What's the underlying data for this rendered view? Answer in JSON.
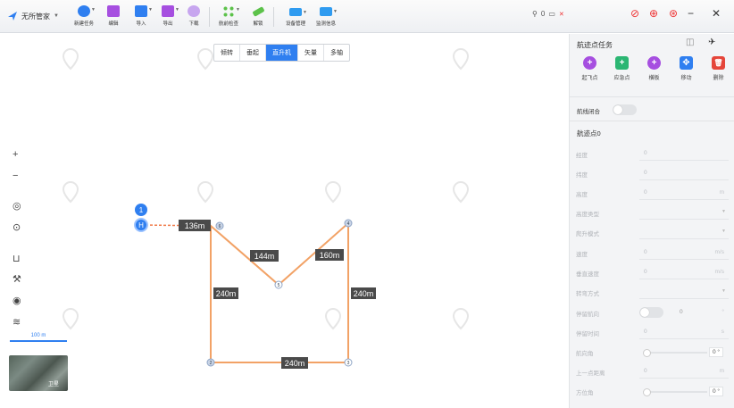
{
  "app": {
    "brand": "无所管家"
  },
  "toolbar": {
    "items": [
      {
        "label": "新建任务",
        "icon": "plus-circle-icon",
        "color": "#2f7ff0"
      },
      {
        "label": "编辑",
        "icon": "edit-icon",
        "color": "#a64fe0"
      },
      {
        "label": "导入",
        "icon": "import-icon",
        "color": "#2f7ff0"
      },
      {
        "label": "导出",
        "icon": "export-icon",
        "color": "#a64fe0"
      },
      {
        "label": "下载",
        "icon": "download-icon",
        "color": "#c7a6ef"
      },
      {
        "label": "航前检查",
        "icon": "checklist-icon",
        "color": "#5cc24a"
      },
      {
        "label": "解锁",
        "icon": "unlock-icon",
        "color": "#5cc24a"
      },
      {
        "label": "设备管理",
        "icon": "device-icon",
        "color": "#2f9bf0"
      },
      {
        "label": "监测信息",
        "icon": "monitor-icon",
        "color": "#2f9bf0"
      }
    ]
  },
  "status": {
    "signal_count": "0"
  },
  "map": {
    "modes": [
      "倾转",
      "垂起",
      "直升机",
      "矢量",
      "多轴"
    ],
    "active_mode": "直升机",
    "left_tools": [
      "+",
      "−"
    ],
    "scale_label": "100 m",
    "thumbnail_label": "卫星",
    "route": {
      "start_labels": [
        "1",
        "H"
      ],
      "distance_labels": [
        "136m",
        "144m",
        "160m",
        "240m",
        "240m",
        "240m"
      ],
      "waypoint_labels": [
        "6",
        "5",
        "4",
        "3",
        "2",
        "1"
      ]
    }
  },
  "panel": {
    "title": "航迹点任务",
    "actions": [
      {
        "label": "起飞点",
        "color": "#a64fe0",
        "glyph": "+"
      },
      {
        "label": "应急点",
        "color": "#2bb673",
        "glyph": "+"
      },
      {
        "label": "横板",
        "color": "#a64fe0",
        "glyph": "+"
      },
      {
        "label": "移动",
        "color": "#2f7ff0",
        "glyph": "✥"
      },
      {
        "label": "删除",
        "color": "#e5453a",
        "glyph": "🗑"
      }
    ],
    "closed_loop_label": "航线闭合",
    "waypoint_title": "航迹点0",
    "fields": [
      {
        "key": "经度",
        "value": "0",
        "unit": ""
      },
      {
        "key": "纬度",
        "value": "0",
        "unit": ""
      },
      {
        "key": "高度",
        "value": "0",
        "unit": "m"
      },
      {
        "key": "高度类型",
        "value": "",
        "unit": "",
        "dropdown": true
      },
      {
        "key": "爬升模式",
        "value": "",
        "unit": "",
        "dropdown": true
      },
      {
        "key": "速度",
        "value": "0",
        "unit": "m/s"
      },
      {
        "key": "垂直速度",
        "value": "0",
        "unit": "m/s"
      },
      {
        "key": "转弯方式",
        "value": "",
        "unit": "",
        "dropdown": true
      },
      {
        "key": "停留航向",
        "value": "0",
        "unit": "°",
        "toggle": true
      },
      {
        "key": "停留时间",
        "value": "0",
        "unit": "s"
      },
      {
        "key": "航向角",
        "value": "0 °",
        "unit": "",
        "slider": true
      },
      {
        "key": "上一点距离",
        "value": "0",
        "unit": "m"
      },
      {
        "key": "方位角",
        "value": "0 °",
        "unit": "",
        "slider": true
      }
    ]
  }
}
